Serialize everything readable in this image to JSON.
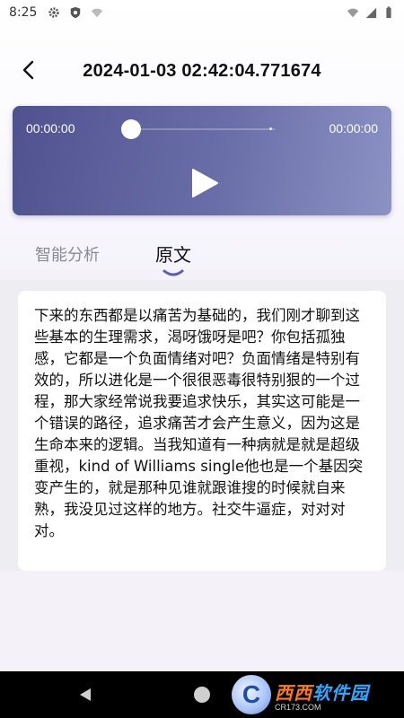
{
  "status_bar": {
    "time": "8:25"
  },
  "header": {
    "title": "2024-01-03 02:42:04.771674"
  },
  "player": {
    "current_time": "00:00:00",
    "total_time": "00:00:00",
    "progress": 0
  },
  "tabs": [
    {
      "label": "智能分析",
      "active": false
    },
    {
      "label": "原文",
      "active": true
    }
  ],
  "transcript": {
    "text": "下来的东西都是以痛苦为基础的，我们刚才聊到这些基本的生理需求，渴呀饿呀是吧？你包括孤独感，它都是一个负面情绪对吧？负面情绪是特别有效的，所以进化是一个很很恶毒很特别狠的一个过程，那大家经常说我要追求快乐，其实这可能是一个错误的路径，追求痛苦才会产生意义，因为这是生命本来的逻辑。当我知道有一种病就是就是超级重视，kind of Williams single他也是一个基因突变产生的，就是那种见谁就跟谁搜的时候就自来熟，我没见过这样的地方。社交牛逼症，对对对对。"
  },
  "watermark": {
    "logo_letter": "C",
    "brand_part1": "西西",
    "brand_part2": "软件园",
    "site": "CR173.COM"
  },
  "colors": {
    "player_start": "#4f528f",
    "player_end": "#8c92c4",
    "tab_indicator": "#5b5fb0",
    "inactive_tab": "#8a8a94"
  }
}
